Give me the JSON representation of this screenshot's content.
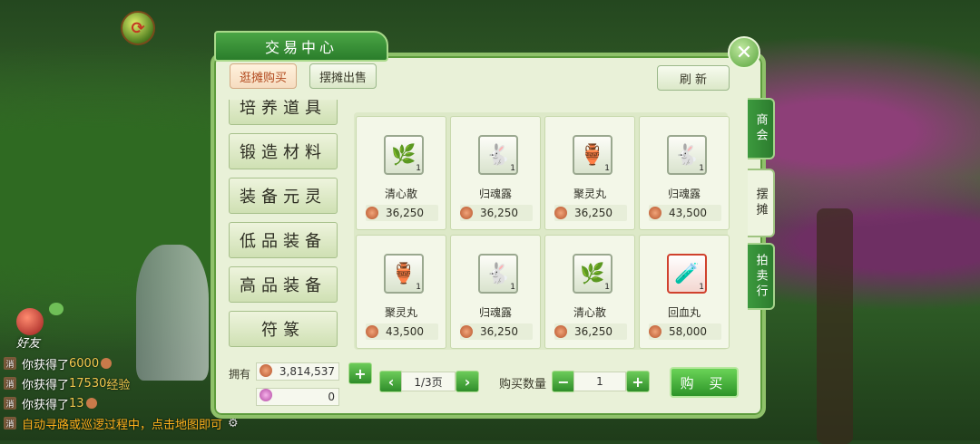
{
  "window": {
    "title": "交易中心"
  },
  "top_icon": "refresh-swap-icon",
  "tabs": {
    "buy": "逛摊购买",
    "sell": "摆摊出售",
    "refresh": "刷 新"
  },
  "categories": [
    "培养道具",
    "锻造材料",
    "装备元灵",
    "低品装备",
    "高品装备",
    "符篆"
  ],
  "items": [
    {
      "name": "清心散",
      "price": "36,250",
      "count": "1",
      "icon": "green-herb-icon",
      "highlight": false
    },
    {
      "name": "归魂露",
      "price": "36,250",
      "count": "1",
      "icon": "spirit-dew-icon",
      "highlight": false
    },
    {
      "name": "聚灵丸",
      "price": "36,250",
      "count": "1",
      "icon": "jar-icon",
      "highlight": false
    },
    {
      "name": "归魂露",
      "price": "43,500",
      "count": "1",
      "icon": "spirit-dew-icon",
      "highlight": false
    },
    {
      "name": "聚灵丸",
      "price": "43,500",
      "count": "1",
      "icon": "jar-icon",
      "highlight": false
    },
    {
      "name": "归魂露",
      "price": "36,250",
      "count": "1",
      "icon": "spirit-dew-icon",
      "highlight": false
    },
    {
      "name": "清心散",
      "price": "36,250",
      "count": "1",
      "icon": "green-herb-icon",
      "highlight": false
    },
    {
      "name": "回血丸",
      "price": "58,000",
      "count": "1",
      "icon": "blue-potion-icon",
      "highlight": true
    }
  ],
  "side_tabs": [
    "商会",
    "摆摊",
    "拍卖行"
  ],
  "footer": {
    "owned_label": "拥有",
    "coins": "3,814,537",
    "gems": "0",
    "page": "1/3页",
    "qty_label": "购买数量",
    "qty": "1",
    "buy_label": "购 买"
  },
  "chat": {
    "friend_label": "好友",
    "lines": [
      {
        "tag": "消",
        "text": "你获得了",
        "value": "6000",
        "suffix": ""
      },
      {
        "tag": "消",
        "text": "你获得了",
        "value": "17530",
        "suffix": "经验"
      },
      {
        "tag": "消",
        "text": "你获得了",
        "value": "13",
        "suffix": ""
      },
      {
        "tag": "消",
        "text": "自动寻路或巡逻过程中，点击地图即可",
        "value": "",
        "suffix": ""
      }
    ]
  },
  "colors": {
    "panel_bg": "#e9f1d8",
    "accent_green": "#2f8d2a",
    "price_text": "#2f2f25",
    "highlight_red": "#d0412d"
  }
}
